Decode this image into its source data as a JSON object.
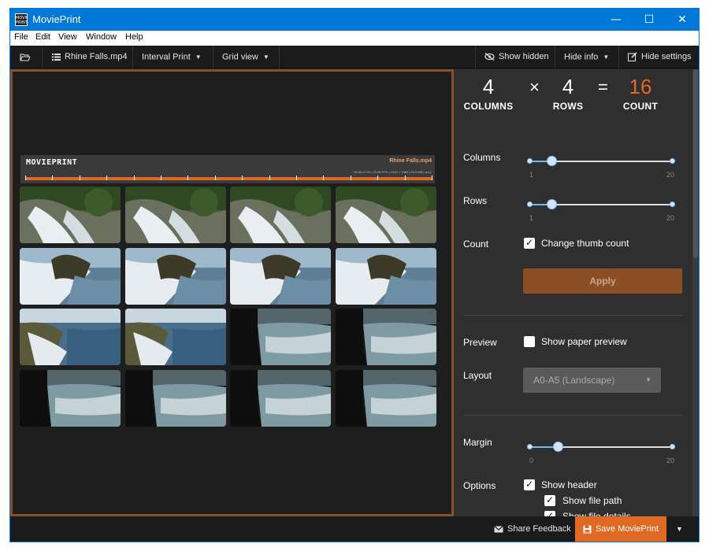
{
  "window": {
    "title": "MoviePrint",
    "logo_text": "MOVIE PRINT",
    "minimize": "—",
    "maximize": "☐",
    "close": "✕"
  },
  "menu": [
    "File",
    "Edit",
    "View",
    "Window",
    "Help"
  ],
  "toolbar": {
    "file_name": "Rhine Falls.mp4",
    "mode": "Interval Print",
    "view": "Grid view",
    "show_hidden": "Show hidden",
    "hide_info": "Hide info",
    "hide_settings": "Hide settings"
  },
  "print_header": {
    "logo": "MOVIEPRINT",
    "filename": "Rhine Falls.mp4",
    "details": "00:00:27:00 | 29.98 FPS | 1920 × 1080 | 53.5 MB | avc1"
  },
  "summary": {
    "columns_value": "4",
    "columns_label": "COLUMNS",
    "times": "×",
    "rows_value": "4",
    "rows_label": "ROWS",
    "equals": "=",
    "count_value": "16",
    "count_label": "COUNT"
  },
  "settings": {
    "columns": {
      "label": "Columns",
      "value": 4,
      "min": "1",
      "max": "20"
    },
    "rows": {
      "label": "Rows",
      "value": 4,
      "min": "1",
      "max": "20"
    },
    "count": {
      "label": "Count",
      "checkbox_label": "Change thumb count",
      "checked": true
    },
    "apply": "Apply",
    "preview": {
      "label": "Preview",
      "checkbox_label": "Show paper preview",
      "checked": false
    },
    "layout": {
      "label": "Layout",
      "selected": "A0-A5 (Landscape)"
    },
    "margin": {
      "label": "Margin",
      "value": 4,
      "min": "0",
      "max": "20"
    },
    "options": {
      "label": "Options",
      "show_header": "Show header",
      "show_file_path": "Show file path",
      "show_file_details": "Show file details"
    }
  },
  "bottom": {
    "share": "Share Feedback",
    "save": "Save MoviePrint"
  },
  "colors": {
    "accent": "#e06a24",
    "titlebar": "#0078d7",
    "panel": "#2f2f2f",
    "canvas_border": "#8a4f22"
  },
  "thumbnails": [
    {
      "scene": "waterfall-rocks"
    },
    {
      "scene": "waterfall-rocks"
    },
    {
      "scene": "waterfall-rocks"
    },
    {
      "scene": "waterfall-rocks"
    },
    {
      "scene": "waterfall-close"
    },
    {
      "scene": "waterfall-close"
    },
    {
      "scene": "waterfall-close"
    },
    {
      "scene": "waterfall-close"
    },
    {
      "scene": "river-rocks"
    },
    {
      "scene": "river-rocks"
    },
    {
      "scene": "rapids-dark"
    },
    {
      "scene": "rapids-dark"
    },
    {
      "scene": "rapids-dark"
    },
    {
      "scene": "rapids-dark"
    },
    {
      "scene": "rapids-dark"
    },
    {
      "scene": "rapids-dark"
    }
  ]
}
